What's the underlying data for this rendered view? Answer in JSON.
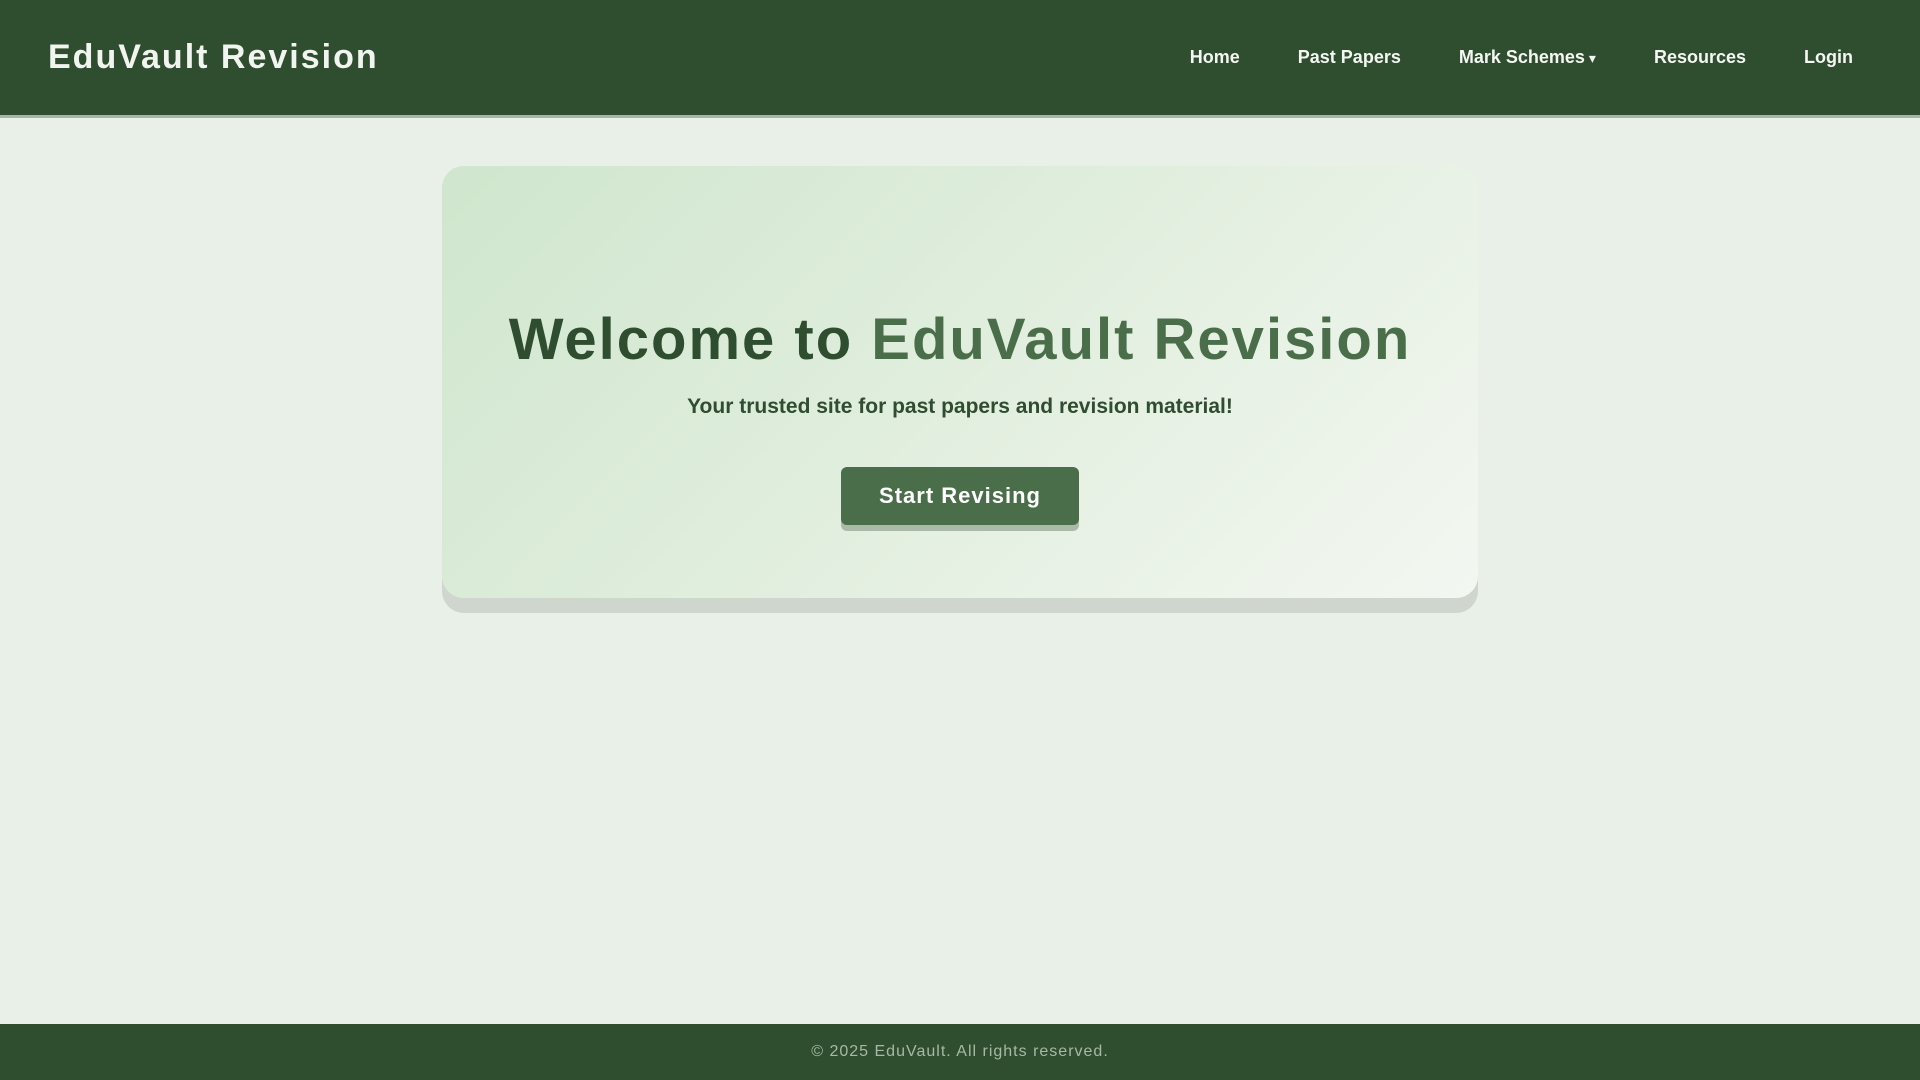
{
  "header": {
    "brand": "EduVault Revision",
    "nav": {
      "home": "Home",
      "past_papers": "Past Papers",
      "mark_schemes": "Mark Schemes",
      "mark_schemes_caret": "▾",
      "resources": "Resources",
      "login": "Login"
    }
  },
  "hero": {
    "title_prefix": "Welcome to ",
    "title_accent": "EduVault Revision",
    "subtitle": "Your trusted site for past papers and revision material!",
    "cta_label": "Start Revising"
  },
  "footer": {
    "text": "© 2025 EduVault. All rights reserved."
  },
  "colors": {
    "primary_dark": "#2f4d2f",
    "primary": "#4a6e4a",
    "background": "#e9f0e8",
    "hero_gradient_start": "#cfe6cd",
    "hero_gradient_end": "#f3f7f1"
  }
}
